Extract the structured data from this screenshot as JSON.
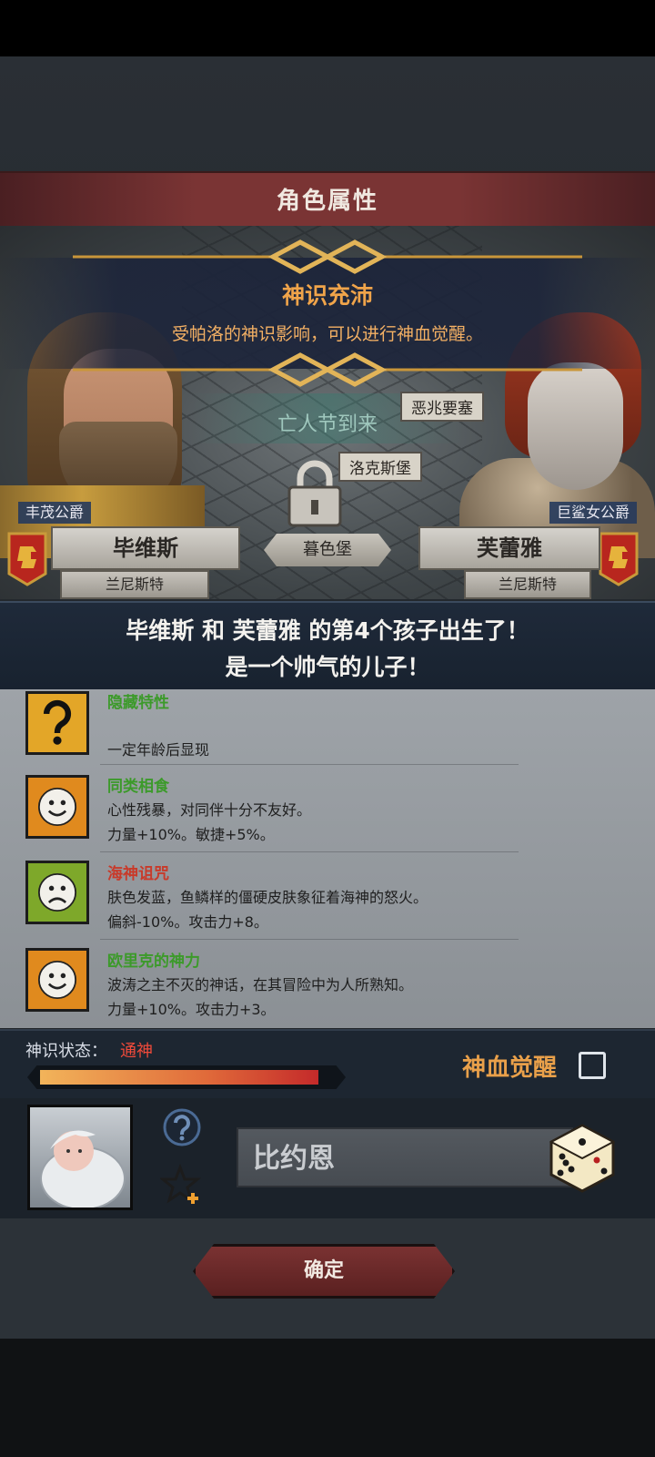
{
  "header": {
    "title": "角色属性"
  },
  "banner": {
    "title": "神识充沛",
    "description": "受帕洛的神识影响，可以进行神血觉醒。"
  },
  "map": {
    "event_label": "亡人节到来",
    "castle_top": "恶兆要塞",
    "castle_mid": "洛克斯堡",
    "castle_bottom": "暮色堡"
  },
  "father": {
    "title": "丰茂公爵",
    "name": "毕维斯",
    "house": "兰尼斯特"
  },
  "mother": {
    "title": "巨鲨女公爵",
    "name": "芙蕾雅",
    "house": "兰尼斯特"
  },
  "announcement": {
    "line1": "毕维斯 和 芙蕾雅 的第4个孩子出生了！",
    "line2": "是一个帅气的儿子！"
  },
  "traits": [
    {
      "name": "隐藏特性",
      "name_color": "#3c9a2a",
      "icon": "question-mark-icon",
      "desc": [
        "",
        "一定年龄后显现"
      ]
    },
    {
      "name": "同类相食",
      "name_color": "#3c9a2a",
      "icon": "happy-face-icon",
      "desc": [
        "心性残暴，对同伴十分不友好。",
        "力量+10%。敏捷+5%。"
      ]
    },
    {
      "name": "海神诅咒",
      "name_color": "#c83a2a",
      "icon": "sad-face-icon",
      "desc": [
        "肤色发蓝，鱼鳞样的僵硬皮肤象征着海神的怒火。",
        "偏斜-10%。攻击力+8。"
      ]
    },
    {
      "name": "欧里克的神力",
      "name_color": "#3c9a2a",
      "icon": "happy-face-icon",
      "desc": [
        "波涛之主不灭的神话，在其冒险中为人所熟知。",
        "力量+10%。攻击力+3。"
      ]
    }
  ],
  "status": {
    "label": "神识状态：",
    "value": "通神",
    "fill_fraction": 0.95,
    "awaken_label": "神血觉醒",
    "awaken_checked": false
  },
  "child": {
    "name": "比约恩"
  },
  "confirm_label": "确定",
  "colors": {
    "accent_orange": "#f0a44a",
    "status_red": "#f04a3a",
    "trait_good": "#3c9a2a",
    "trait_bad": "#c83a2a"
  }
}
